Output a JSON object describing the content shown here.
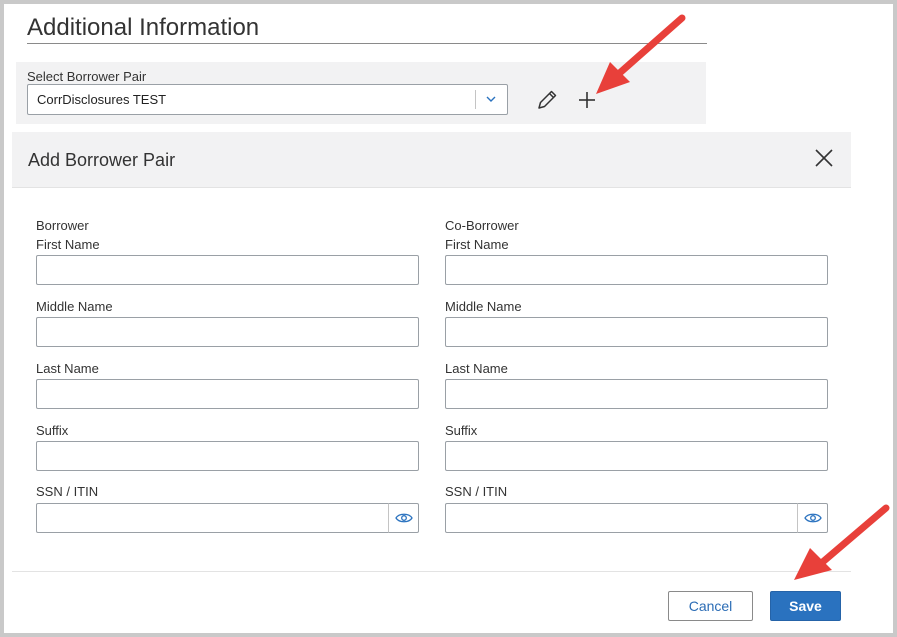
{
  "page": {
    "title": "Additional Information"
  },
  "borrower_pair": {
    "label": "Select Borrower Pair",
    "selected": "CorrDisclosures TEST",
    "icons": [
      "chevron-down-icon",
      "pencil-icon",
      "plus-icon"
    ]
  },
  "dialog": {
    "title": "Add Borrower Pair",
    "close_icon": "close-icon",
    "borrower": {
      "heading": "Borrower",
      "fields": [
        {
          "label": "First Name",
          "value": ""
        },
        {
          "label": "Middle Name",
          "value": ""
        },
        {
          "label": "Last Name",
          "value": ""
        },
        {
          "label": "Suffix",
          "value": ""
        },
        {
          "label": "SSN / ITIN",
          "value": ""
        }
      ]
    },
    "co_borrower": {
      "heading": "Co-Borrower",
      "fields": [
        {
          "label": "First Name",
          "value": ""
        },
        {
          "label": "Middle Name",
          "value": ""
        },
        {
          "label": "Last Name",
          "value": ""
        },
        {
          "label": "Suffix",
          "value": ""
        },
        {
          "label": "SSN / ITIN",
          "value": ""
        }
      ]
    },
    "buttons": {
      "cancel_label": "Cancel",
      "save_label": "Save"
    }
  },
  "colors": {
    "accent": "#2a72bf",
    "annotation_arrow": "#e8403a"
  }
}
